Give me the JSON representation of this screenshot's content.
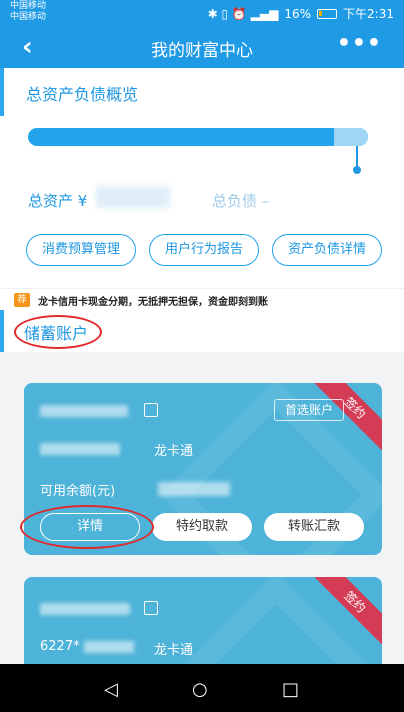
{
  "status": {
    "carrier_1": "中国移动",
    "carrier_2": "中国移动",
    "battery": "16%",
    "time": "下午2:31"
  },
  "header": {
    "back": "‹",
    "title": "我的财富中心",
    "more": "•••"
  },
  "overview": {
    "section_title": "总资产负债概览",
    "assets_label": "总资产 ¥",
    "debt_label": "总负债 –",
    "debt_ratio": 0.1,
    "buttons": [
      "消费预算管理",
      "用户行为报告",
      "资产负债详情"
    ]
  },
  "promo": {
    "tag": "荐",
    "text": "龙卡信用卡现金分期，无抵押无担保，资金即刻到账"
  },
  "savings": {
    "title": "储蓄账户"
  },
  "cards": [
    {
      "ribbon": "签约",
      "primary_badge": "首选账户",
      "card_type": "龙卡通",
      "available_label": "可用余额(元)",
      "buttons": [
        "详情",
        "特约取款",
        "转账汇款"
      ]
    },
    {
      "ribbon": "签约",
      "account_prefix": "6227*",
      "card_type": "龙卡通"
    }
  ],
  "icons": [
    "back-icon",
    "more-icon",
    "edit-icon",
    "battery-icon",
    "back-nav-icon",
    "home-nav-icon",
    "recents-nav-icon"
  ]
}
